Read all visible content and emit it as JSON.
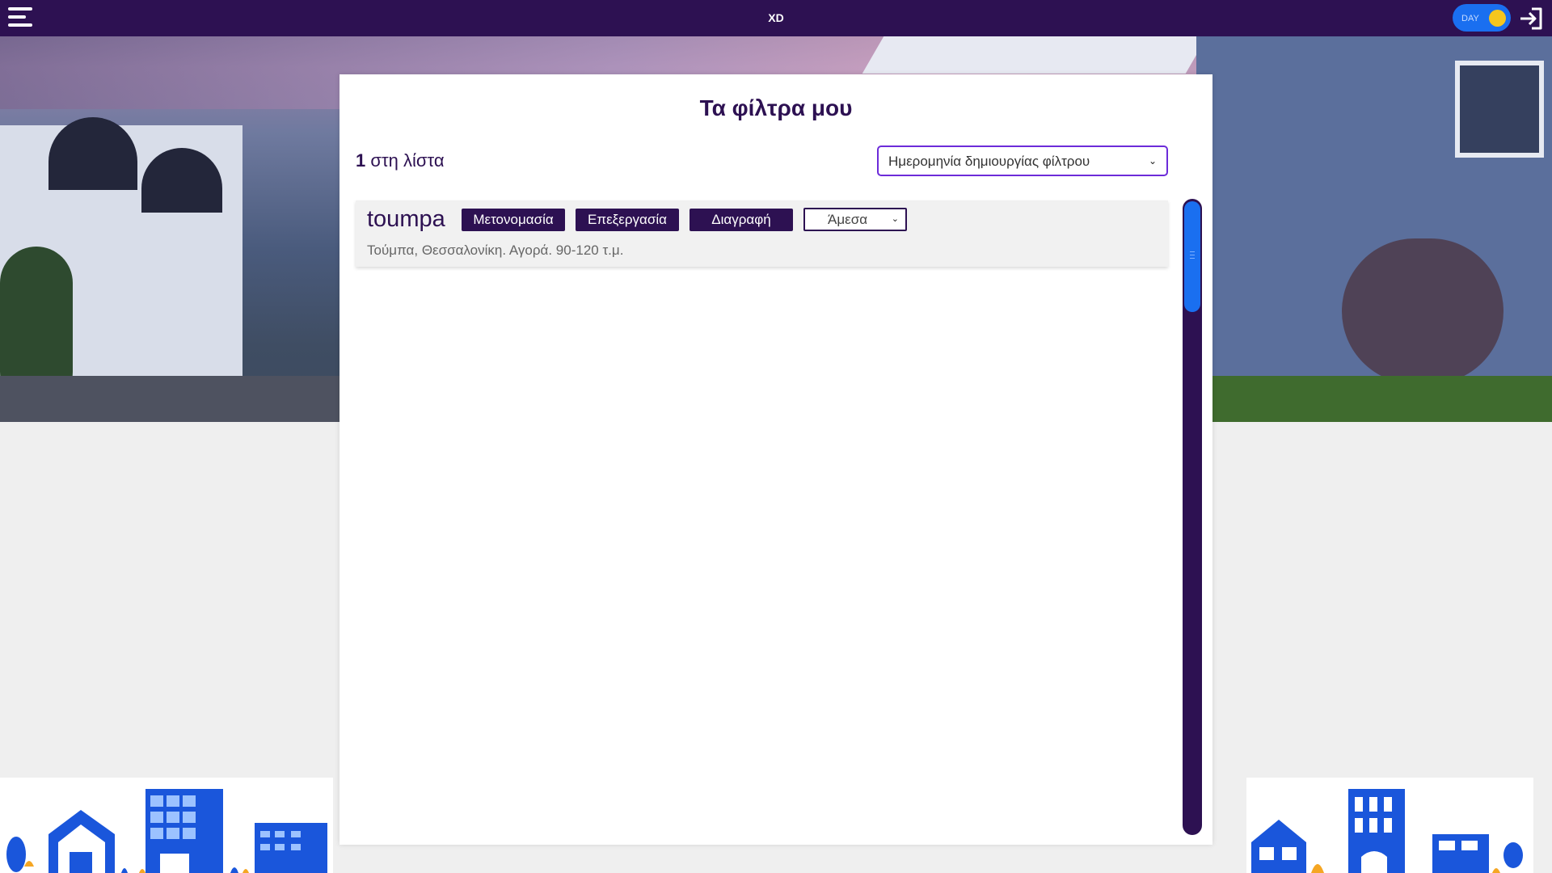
{
  "topbar": {
    "brand": "XD",
    "theme_toggle_label": "DAY",
    "icons": {
      "menu": "hamburger-menu-icon",
      "login": "login-icon"
    }
  },
  "page": {
    "title": "Τα φίλτρα μου",
    "count_number": "1",
    "count_suffix": " στη λίστα",
    "sort": {
      "selected": "Ημερομηνία δημιουργίας φίλτρου"
    }
  },
  "filters": [
    {
      "name": "toumpa",
      "rename_label": "Μετονομασία",
      "edit_label": "Επεξεργασία",
      "delete_label": "Διαγραφή",
      "frequency": "Άμεσα",
      "description": "Τούμπα, Θεσσαλονίκη. Αγορά. 90-120 τ.μ."
    }
  ],
  "colors": {
    "primary": "#2d1152",
    "accent": "#1a6ff0",
    "sort_border": "#6c2bd9",
    "toggle_knob": "#f6c61e"
  }
}
